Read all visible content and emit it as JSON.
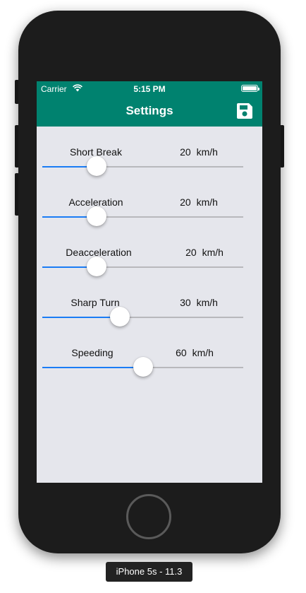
{
  "status_bar": {
    "carrier": "Carrier",
    "time": "5:15 PM"
  },
  "nav": {
    "title": "Settings",
    "save_icon": "floppy-disk-icon"
  },
  "colors": {
    "nav_bg": "#00826f",
    "slider_fill": "#1a7cf5",
    "screen_bg": "#e5e6ec"
  },
  "settings": [
    {
      "label": "Short Break",
      "value": "20",
      "unit": "km/h",
      "slider_fraction": 0.27
    },
    {
      "label": "Acceleration",
      "value": "20",
      "unit": "km/h",
      "slider_fraction": 0.27
    },
    {
      "label": "Deacceleration",
      "value": "20",
      "unit": "km/h",
      "slider_fraction": 0.27
    },
    {
      "label": "Sharp Turn",
      "value": "30",
      "unit": "km/h",
      "slider_fraction": 0.385
    },
    {
      "label": "Speeding",
      "value": "60",
      "unit": "km/h",
      "slider_fraction": 0.5
    }
  ],
  "simulator_label": "iPhone 5s - 11.3"
}
